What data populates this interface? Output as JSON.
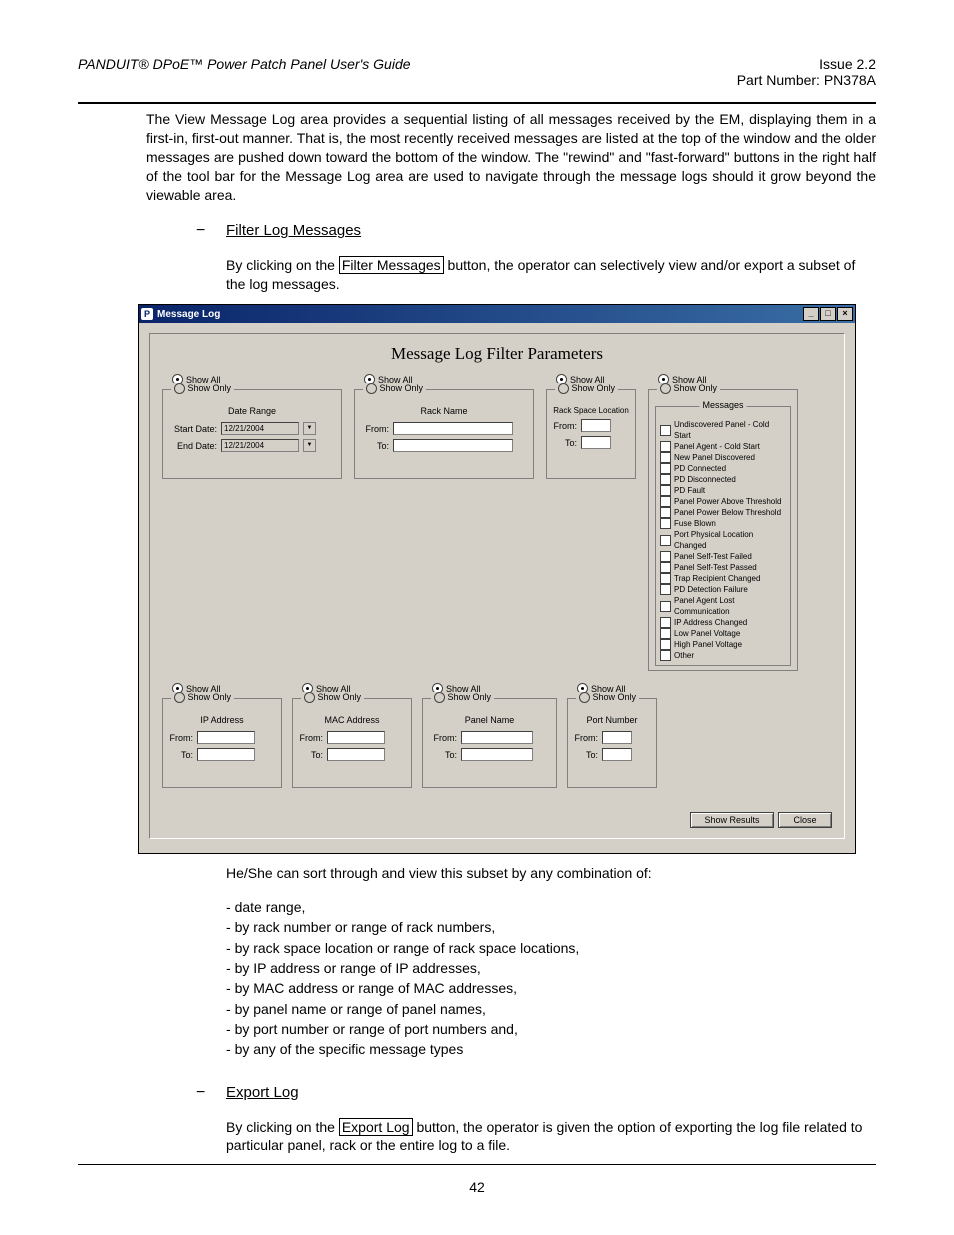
{
  "header": {
    "left": "PANDUIT® DPoE™ Power Patch Panel User's Guide",
    "right1": "Issue 2.2",
    "right2": "Part Number: PN378A"
  },
  "intro_para": "The View Message Log area provides a sequential listing of all messages received by the EM, displaying them in a first-in, first-out manner.  That is, the most recently received messages are listed at the top of the window and the older messages are pushed down toward the bottom of the window.  The \"rewind\" and \"fast-forward\" buttons in the right half of the tool bar for the Message Log area are used to navigate through the message logs should it grow beyond the viewable area.",
  "sec1_title": "Filter Log Messages",
  "sec1_pre": "By clicking on the ",
  "sec1_box": "Filter Messages",
  "sec1_post": " button, the operator can selectively view and/or export a subset of the log messages.",
  "win_title": "Message Log",
  "panel_title": "Message Log Filter Parameters",
  "show_all": "Show All",
  "show_only": "Show Only",
  "date_range": "Date Range",
  "start_date": "Start Date:",
  "end_date": "End Date:",
  "date_val": "12/21/2004",
  "rack_name": "Rack Name",
  "rack_space": "Rack Space Location",
  "from": "From:",
  "to": "To:",
  "ip_addr": "IP Address",
  "mac_addr": "MAC Address",
  "panel_name": "Panel Name",
  "port_number": "Port Number",
  "messages_legend": "Messages",
  "messages": [
    "Undiscovered Panel - Cold Start",
    "Panel Agent - Cold Start",
    "New Panel Discovered",
    "PD Connected",
    "PD Disconnected",
    "PD Fault",
    "Panel Power Above Threshold",
    "Panel Power Below Threshold",
    "Fuse Blown",
    "Port Physical Location Changed",
    "Panel Self-Test Failed",
    "Panel Self-Test Passed",
    "Trap Recipient Changed",
    "PD Detection Failure",
    "Panel Agent Lost Communication",
    "IP Address Changed",
    "Low Panel Voltage",
    "High Panel Voltage",
    "Other"
  ],
  "btn_results": "Show Results",
  "btn_close": "Close",
  "sort_intro": "He/She can sort through and view this subset by any combination of:",
  "bullets": [
    "date range,",
    "by rack number or range of rack numbers,",
    "by rack space location or range of rack space locations,",
    "by IP address or range of IP addresses,",
    "by MAC address or range of MAC addresses,",
    "by panel name or range of panel names,",
    "by port number or range of port numbers and,",
    "by any of the specific message types"
  ],
  "sec2_title": "Export Log",
  "sec2_pre": "By clicking on the ",
  "sec2_box": "Export Log",
  "sec2_post": " button, the operator is given the option of exporting the log file related to particular panel, rack or the entire log to a file.",
  "page_no": "42"
}
